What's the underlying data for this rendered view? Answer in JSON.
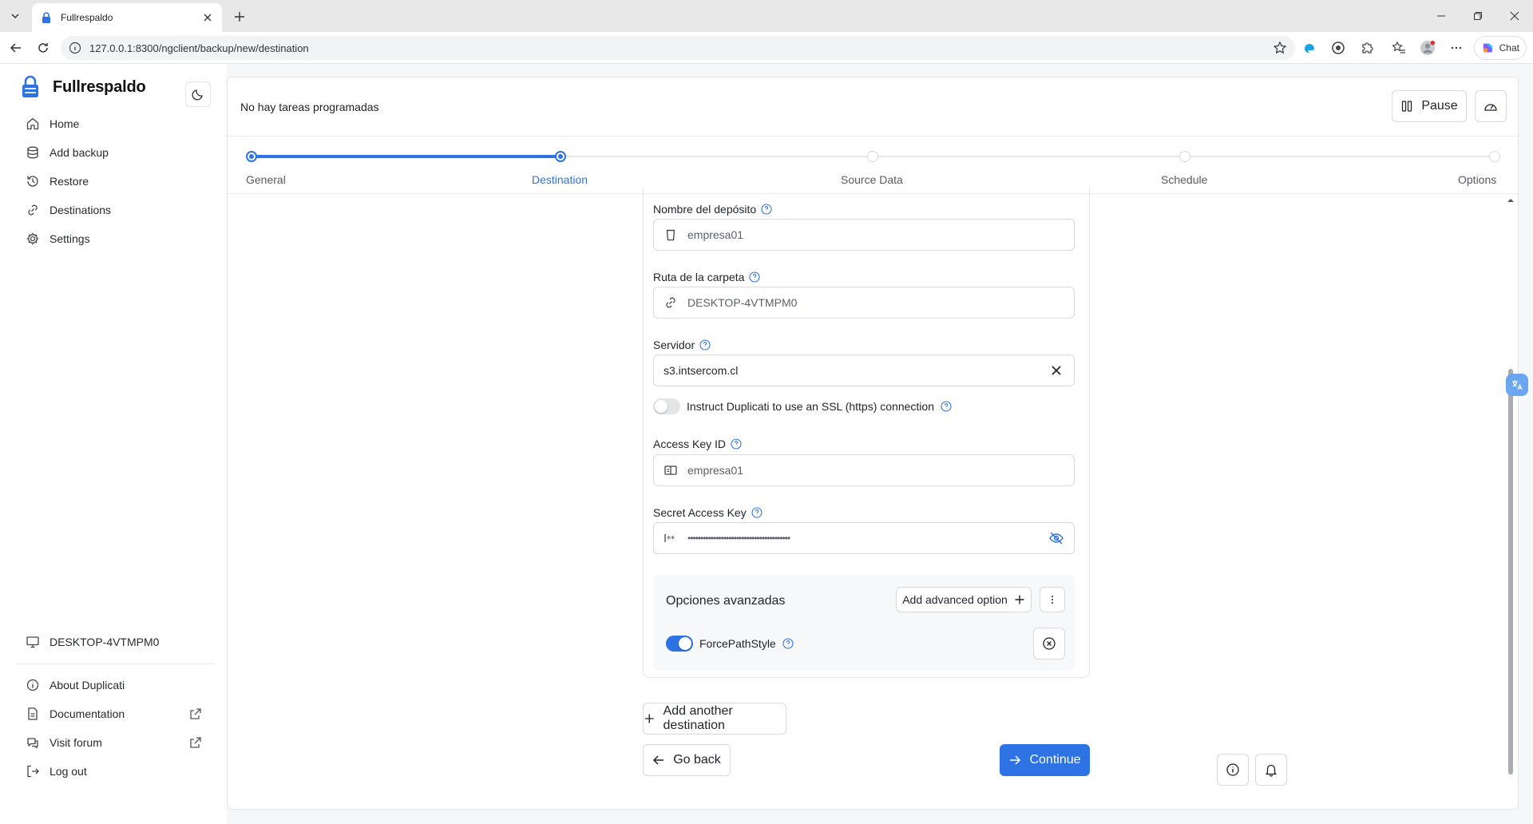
{
  "browser": {
    "tab_title": "Fullrespaldo",
    "url": "127.0.0.1:8300/ngclient/backup/new/destination",
    "chat_label": "Chat"
  },
  "sidebar": {
    "brand": "Fullrespaldo",
    "nav": [
      {
        "label": "Home",
        "icon": "home-icon"
      },
      {
        "label": "Add backup",
        "icon": "database-icon"
      },
      {
        "label": "Restore",
        "icon": "history-icon"
      },
      {
        "label": "Destinations",
        "icon": "link-icon"
      },
      {
        "label": "Settings",
        "icon": "gear-icon"
      }
    ],
    "machine": "DESKTOP-4VTMPM0",
    "footer": [
      {
        "label": "About Duplicati",
        "icon": "info-icon"
      },
      {
        "label": "Documentation",
        "icon": "document-icon"
      },
      {
        "label": "Visit forum",
        "icon": "chat-icon"
      },
      {
        "label": "Log out",
        "icon": "logout-icon"
      }
    ]
  },
  "topbar": {
    "status": "No hay tareas programadas",
    "pause_label": "Pause"
  },
  "stepper": {
    "steps": [
      "General",
      "Destination",
      "Source Data",
      "Schedule",
      "Options"
    ],
    "active_index": 1
  },
  "form": {
    "bucket_label": "Nombre del depósito",
    "bucket_value": "empresa01",
    "folder_label": "Ruta de la carpeta",
    "folder_value": "DESKTOP-4VTMPM0",
    "server_label": "Servidor",
    "server_value": "s3.intsercom.cl",
    "ssl_label": "Instruct Duplicati to use an SSL (https) connection",
    "ssl_enabled": false,
    "access_key_label": "Access Key ID",
    "access_key_value": "empresa01",
    "secret_label": "Secret Access Key",
    "secret_value": "••••••••••••••••••••••••••••••••••••••••",
    "advanced": {
      "title": "Opciones avanzadas",
      "add_label": "Add advanced option",
      "option_label": "ForcePathStyle",
      "option_enabled": true
    }
  },
  "actions": {
    "add_destination": "Add another destination",
    "go_back": "Go back",
    "continue": "Continue"
  },
  "colors": {
    "accent": "#2e73e6",
    "border": "#d6d9de"
  }
}
